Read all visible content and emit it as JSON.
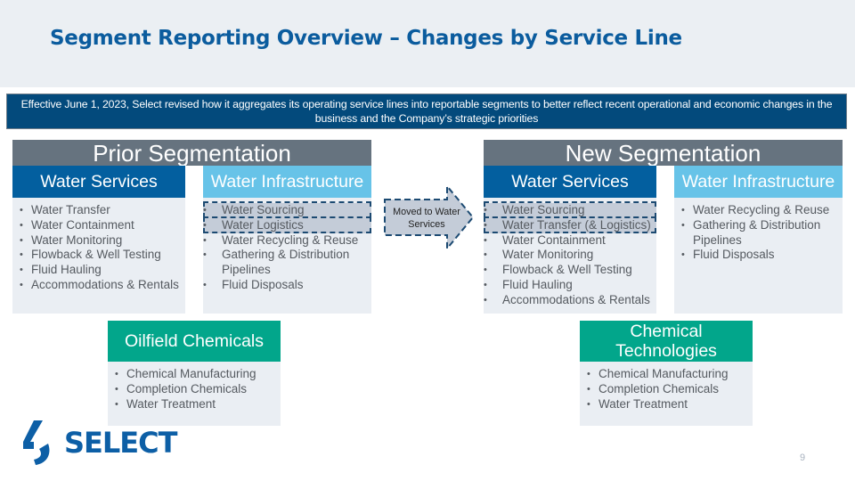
{
  "title": "Segment Reporting Overview – Changes by Service Line",
  "banner": "Effective June 1, 2023, Select revised how it aggregates its operating service lines into reportable segments to better reflect recent operational and economic changes in the business and the Company’s strategic priorities",
  "prior": {
    "heading": "Prior Segmentation",
    "water_services": {
      "title": "Water Services",
      "items": [
        "Water Transfer",
        "Water Containment",
        "Water Monitoring",
        "Flowback & Well Testing",
        "Fluid Hauling",
        "Accommodations & Rentals"
      ]
    },
    "water_infrastructure": {
      "title": "Water Infrastructure",
      "items": [
        "Water Sourcing",
        "Water Logistics",
        "Water Recycling & Reuse",
        "Gathering & Distribution Pipelines",
        "Fluid Disposals"
      ],
      "moved_items": [
        "Water Sourcing",
        "Water Logistics"
      ]
    },
    "chemicals": {
      "title": "Oilfield Chemicals",
      "items": [
        "Chemical Manufacturing",
        "Completion Chemicals",
        "Water Treatment"
      ]
    }
  },
  "arrow_label": "Moved to Water Services",
  "new": {
    "heading": "New Segmentation",
    "water_services": {
      "title": "Water Services",
      "items": [
        "Water Sourcing",
        "Water Transfer (& Logistics)",
        "Water Containment",
        "Water Monitoring",
        "Flowback & Well Testing",
        "Fluid Hauling",
        "Accommodations & Rentals"
      ],
      "moved_items": [
        "Water Sourcing",
        "Water Transfer (& Logistics)"
      ]
    },
    "water_infrastructure": {
      "title": "Water Infrastructure",
      "items": [
        "Water Recycling & Reuse",
        "Gathering & Distribution Pipelines",
        "Fluid Disposals"
      ]
    },
    "chemicals": {
      "title": "Chemical Technologies",
      "items": [
        "Chemical Manufacturing",
        "Completion Chemicals",
        "Water Treatment"
      ]
    }
  },
  "logo": {
    "text": "SELECT",
    "icon": "select-logo-icon"
  },
  "page_number": "9",
  "colors": {
    "title": "#0b5c9e",
    "banner": "#034a7c",
    "section_head": "#66737f",
    "water_services": "#035f9f",
    "water_infrastructure": "#67c3e8",
    "chemicals": "#02a68b",
    "box_bg": "#eaeef3"
  }
}
